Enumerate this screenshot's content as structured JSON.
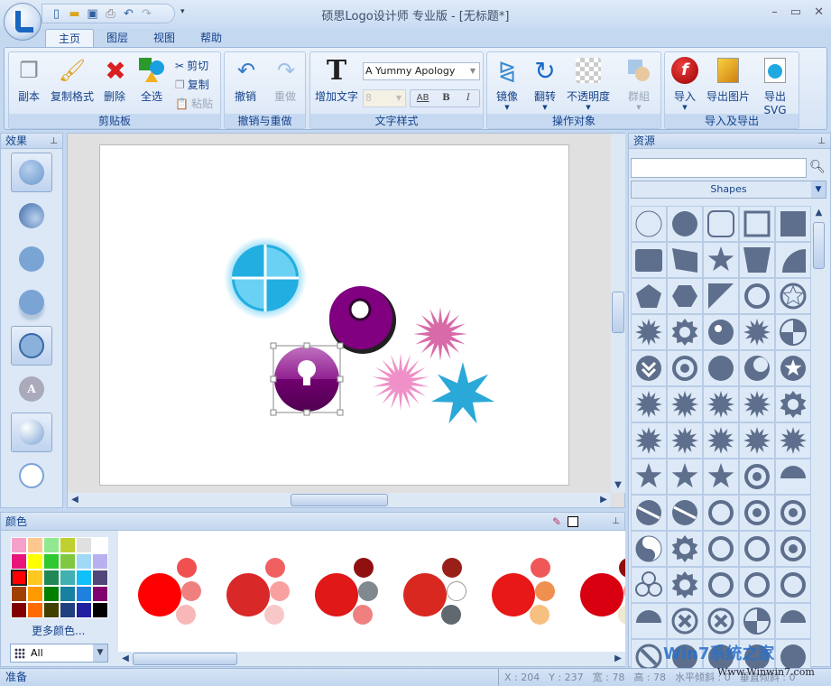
{
  "app": {
    "title": "硕思Logo设计师 专业版 - [无标题*]"
  },
  "quick_access": [
    "new-icon",
    "open-icon",
    "save-icon",
    "print-icon",
    "undo-icon",
    "redo-icon"
  ],
  "tabs": [
    "主页",
    "图层",
    "视图",
    "帮助"
  ],
  "ribbon": {
    "clipboard": {
      "label": "剪贴板",
      "duplicate": "副本",
      "format_painter": "复制格式",
      "delete": "删除",
      "select_all": "全选",
      "cut": "剪切",
      "copy": "复制",
      "paste": "粘贴"
    },
    "undo_redo": {
      "label": "撤销与重做",
      "undo": "撤销",
      "redo": "重做"
    },
    "text_style": {
      "label": "文字样式",
      "add_text": "增加文字",
      "font": "A Yummy Apology",
      "size": "8",
      "bold": "B",
      "italic": "I",
      "spacing": "AB"
    },
    "objects": {
      "label": "操作对象",
      "mirror": "镜像",
      "rotate": "翻转",
      "opacity": "不透明度",
      "group": "群組"
    },
    "import_export": {
      "label": "导入及导出",
      "import": "导入",
      "export_image": "导出图片",
      "export_svg": "导出SVG"
    }
  },
  "effects": {
    "title": "效果"
  },
  "resources": {
    "title": "资源",
    "search_value": "",
    "category": "Shapes",
    "shapes": [
      "circle-outline",
      "circle",
      "rounded-square-outline",
      "square-outline",
      "square",
      "rounded-square",
      "quad",
      "star",
      "trapezoid",
      "quarter",
      "pentagon",
      "hexagon",
      "triangle",
      "ring",
      "pentagram-circle",
      "burst",
      "gear",
      "dot-circle",
      "burst",
      "pie",
      "chevron-circle",
      "ring-dot",
      "circle",
      "crescent",
      "star-circle",
      "burst",
      "burst",
      "burst",
      "burst",
      "gear",
      "burst",
      "burst",
      "burst",
      "burst",
      "burst",
      "star",
      "star",
      "star",
      "ring-dot",
      "semicircle",
      "ball",
      "ball",
      "ring",
      "ring-dot",
      "ring-dot",
      "yinyang",
      "gear",
      "ring",
      "ring",
      "ring-dot",
      "trefoil",
      "gear",
      "ring",
      "ring",
      "ring",
      "semicircle",
      "x-circle",
      "x-circle",
      "pie",
      "semicircle",
      "slash-circle",
      "circle",
      "circle",
      "circle",
      "circle"
    ]
  },
  "colors": {
    "title": "颜色",
    "more": "更多颜色...",
    "set": "All",
    "swatches": [
      "#f4a0c8",
      "#fcc890",
      "#90e890",
      "#c0d030",
      "#e0e0e0",
      "#ffffff",
      "#e8157a",
      "#ffff00",
      "#30c830",
      "#80c840",
      "#a0d8f8",
      "#b8b0f0",
      "#ff0000",
      "#ffc820",
      "#208858",
      "#40b0b0",
      "#10c0f8",
      "#504878",
      "#a04000",
      "#ff9a00",
      "#008000",
      "#1880a0",
      "#2080e0",
      "#800070",
      "#800000",
      "#ff6a00",
      "#404000",
      "#204080",
      "#2020a0",
      "#000000"
    ],
    "selected": 12,
    "schemes": [
      [
        "#ff0000",
        "#f05050",
        "#f08080",
        "#f8b8b8"
      ],
      [
        "#d82828",
        "#f06060",
        "#f8a0a0",
        "#f8c8c8"
      ],
      [
        "#e01818",
        "#901010",
        "#808890",
        "#f08080"
      ],
      [
        "#d82820",
        "#982018",
        "#ffffff",
        "#606870"
      ],
      [
        "#e81818",
        "#f05858",
        "#f09050",
        "#f8c080"
      ],
      [
        "#d80010",
        "#901010",
        "#f8a0a0",
        "#f0e8d0"
      ]
    ]
  },
  "status": {
    "ready": "准备",
    "x": "X : 204",
    "y": "Y : 237",
    "w": "宽 : 78",
    "h": "高 : 78",
    "hskew": "水平倾斜 : 0",
    "vskew": "垂直倾斜 : 0"
  },
  "watermark": {
    "brand": "Win7系统之家",
    "url": "Www.Winwin7.com"
  }
}
